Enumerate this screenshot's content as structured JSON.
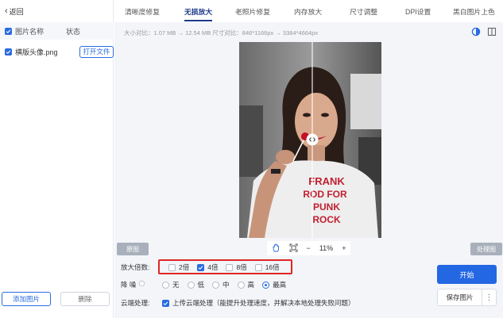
{
  "sidebar": {
    "back_label": "返回",
    "header": {
      "name_col": "图片名称",
      "status_col": "状态"
    },
    "files": [
      {
        "name": "横版头像.png",
        "action": "打开文件"
      }
    ],
    "add_label": "添加图片",
    "delete_label": "删除"
  },
  "tabs": [
    {
      "label": "清晰度修复",
      "active": false
    },
    {
      "label": "无损放大",
      "active": true
    },
    {
      "label": "老照片修复",
      "active": false
    },
    {
      "label": "内存放大",
      "active": false
    },
    {
      "label": "尺寸调整",
      "active": false
    },
    {
      "label": "DPI设置",
      "active": false
    },
    {
      "label": "黑白图片上色",
      "active": false
    }
  ],
  "size_info": {
    "text": "大小对比：1.07 MB → 12.54 MB  尺寸对比：846*1166px → 3384*4664px"
  },
  "preview": {
    "before_label": "原图",
    "after_label": "处理图",
    "shirt_text": [
      "FRANK",
      "ROD FOR",
      "PUNK",
      "ROCK"
    ]
  },
  "zoom": {
    "minus": "−",
    "value": "11%",
    "plus": "+"
  },
  "scale": {
    "label": "放大倍数:",
    "options": [
      {
        "label": "2倍",
        "checked": false
      },
      {
        "label": "4倍",
        "checked": true
      },
      {
        "label": "8倍",
        "checked": false
      },
      {
        "label": "16倍",
        "checked": false
      }
    ]
  },
  "denoise": {
    "label": "降 噪",
    "options": [
      {
        "label": "无",
        "selected": false
      },
      {
        "label": "低",
        "selected": false
      },
      {
        "label": "中",
        "selected": false
      },
      {
        "label": "高",
        "selected": false
      },
      {
        "label": "最高",
        "selected": true
      }
    ]
  },
  "cloud": {
    "label": "云端处理:",
    "option": "上传云端处理（能提升处理速度，并解决本地处理失败问题）",
    "checked": true
  },
  "buttons": {
    "start": "开始",
    "save": "保存图片",
    "more": "⋮"
  },
  "colors": {
    "accent": "#2467e3",
    "tab_active": "#1d3a8a",
    "highlight": "#e02525"
  }
}
